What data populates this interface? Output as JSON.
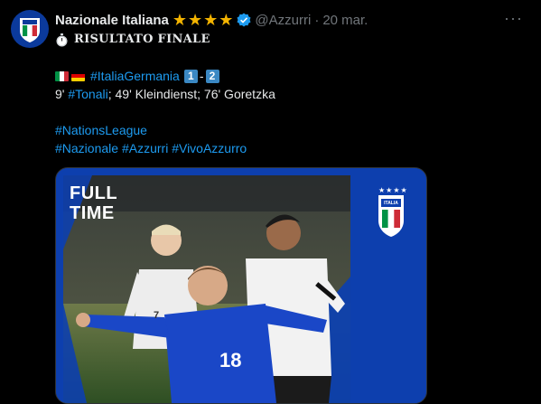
{
  "tweet": {
    "display_name": "Nazionale Italiana",
    "stars": "★★★★",
    "handle": "@Azzurri",
    "separator": "·",
    "date": "20 mar.",
    "more": "···",
    "title": "RISULTATO FINALE",
    "hashtag_match": "#ItaliaGermania",
    "score_home": "1",
    "score_dash": "-",
    "score_away": "2",
    "scorers": {
      "minute_1": "9' ",
      "hashtag_tonali": "#Tonali",
      "rest": "; 49' Kleindienst; 76' Goretzka"
    },
    "hashtag_nations": "#NationsLeague",
    "hashtag_nazionale": "#Nazionale",
    "hashtag_azzurri": "#Azzurri",
    "hashtag_vivo": "#VivoAzzurro"
  },
  "media": {
    "ft_line1": "FULL",
    "ft_line2": "TIME",
    "crest_text": "ITALIA",
    "crest_stars": "★★★★",
    "jersey_number": "18",
    "shorts_number": "7"
  },
  "colors": {
    "accent_link": "#1d9bf0",
    "star_gold": "#f4b400",
    "verified": "#1d9bf0",
    "azzurri_blue": "#0d3fae"
  },
  "icons": {
    "avatar": "italy-crest-icon",
    "verified": "verified-badge-icon",
    "stopwatch": "stopwatch-icon",
    "flag_it": "italy-flag-icon",
    "flag_de": "germany-flag-icon"
  }
}
